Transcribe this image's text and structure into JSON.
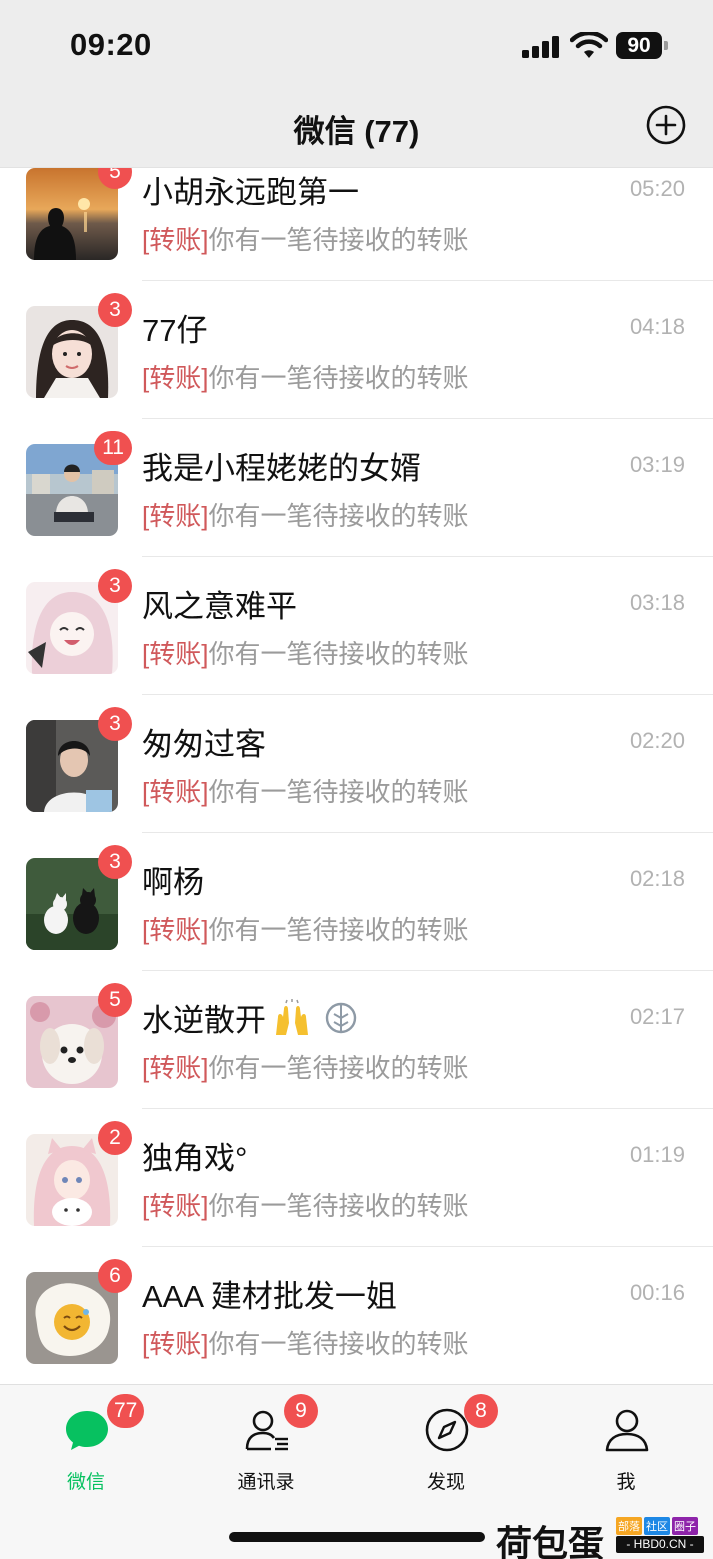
{
  "status_bar": {
    "time": "09:20",
    "battery": "90"
  },
  "nav": {
    "title": "微信 (77)"
  },
  "chats": [
    {
      "name": "小胡永远跑第一",
      "tag": "[转账]",
      "message": "你有一笔待接收的转账",
      "time": "05:20",
      "unread": "5",
      "avatar": "sunset-silhouette"
    },
    {
      "name": "77仔",
      "tag": "[转账]",
      "message": "你有一笔待接收的转账",
      "time": "04:18",
      "unread": "3",
      "avatar": "girl-portrait"
    },
    {
      "name": "我是小程姥姥的女婿",
      "tag": "[转账]",
      "message": "你有一笔待接收的转账",
      "time": "03:19",
      "unread": "11",
      "avatar": "man-sitting-outdoor"
    },
    {
      "name": "风之意难平",
      "tag": "[转账]",
      "message": "你有一笔待接收的转账",
      "time": "03:18",
      "unread": "3",
      "avatar": "anime-girl"
    },
    {
      "name": "匆匆过客",
      "tag": "[转账]",
      "message": "你有一笔待接收的转账",
      "time": "02:20",
      "unread": "3",
      "avatar": "young-man"
    },
    {
      "name": "啊杨",
      "tag": "[转账]",
      "message": "你有一笔待接收的转账",
      "time": "02:18",
      "unread": "3",
      "avatar": "two-cats"
    },
    {
      "name": "水逆散开",
      "tag": "[转账]",
      "message": "你有一笔待接收的转账",
      "time": "02:17",
      "unread": "5",
      "avatar": "white-puppy",
      "emoji": "raising-hands-emoji",
      "muted": true
    },
    {
      "name": "独角戏°",
      "tag": "[转账]",
      "message": "你有一笔待接收的转账",
      "time": "01:19",
      "unread": "2",
      "avatar": "anime-girl-cat"
    },
    {
      "name": "AAA 建材批发一姐",
      "tag": "[转账]",
      "message": "你有一笔待接收的转账",
      "time": "00:16",
      "unread": "6",
      "avatar": "egg-emoji"
    }
  ],
  "tabs": [
    {
      "label": "微信",
      "badge": "77",
      "icon": "chat-bubble-icon",
      "active": true
    },
    {
      "label": "通讯录",
      "badge": "9",
      "icon": "contacts-icon",
      "active": false
    },
    {
      "label": "发现",
      "badge": "8",
      "icon": "compass-icon",
      "active": false
    },
    {
      "label": "我",
      "badge": "",
      "icon": "person-icon",
      "active": false
    }
  ],
  "watermark": {
    "text": "荷包蛋",
    "tags": [
      "部落",
      "社区",
      "圈子"
    ],
    "url": "- HBD0.CN -"
  },
  "colors": {
    "accent": "#07c160",
    "badge": "#f05050",
    "transfer_tag": "#d0595b",
    "nav_bg": "#ededed"
  }
}
